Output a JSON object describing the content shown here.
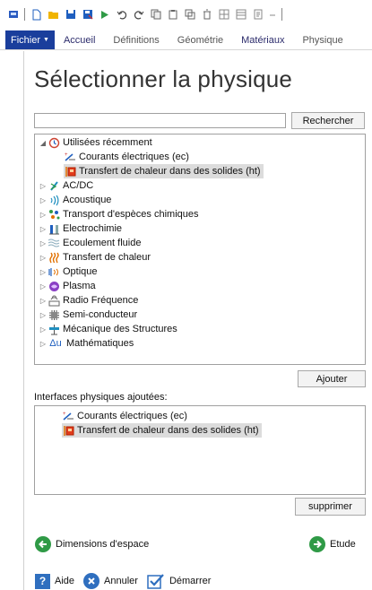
{
  "ribbon": {
    "file_label": "Fichier",
    "tabs": [
      "Accueil",
      "Définitions",
      "Géométrie",
      "Matériaux",
      "Physique"
    ]
  },
  "panel": {
    "title": "Sélectionner la physique",
    "search_value": "",
    "search_button": "Rechercher",
    "add_button": "Ajouter",
    "added_label": "Interfaces physiques ajoutées:",
    "remove_button": "supprimer",
    "back_nav": "Dimensions d'espace",
    "next_nav": "Etude"
  },
  "tree": {
    "recent": {
      "label": "Utilisées récemment",
      "children": [
        "Courants électriques (ec)",
        "Transfert de chaleur dans des solides (ht)"
      ]
    },
    "categories": [
      "AC/DC",
      "Acoustique",
      "Transport d'espèces chimiques",
      "Electrochimie",
      "Ecoulement fluide",
      "Transfert de chaleur",
      "Optique",
      "Plasma",
      "Radio Fréquence",
      "Semi-conducteur",
      "Mécanique des Structures",
      "Mathématiques"
    ]
  },
  "added": [
    "Courants électriques (ec)",
    "Transfert de chaleur dans des solides (ht)"
  ],
  "footer": {
    "help": "Aide",
    "cancel": "Annuler",
    "start": "Démarrer"
  },
  "colors": {
    "file_tab": "#1a3e9c",
    "nav_green": "#2f9a46",
    "help_blue": "#2f6fbf",
    "selection": "#dcdcdc"
  }
}
